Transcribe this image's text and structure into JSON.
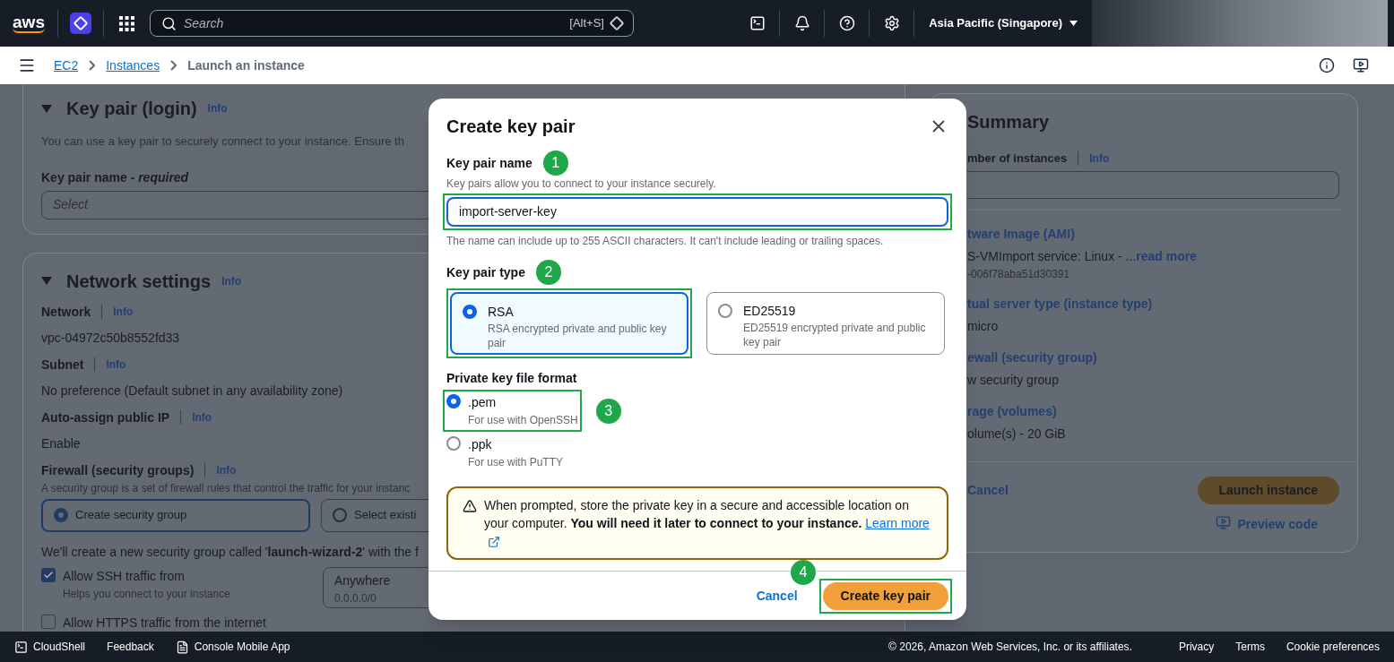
{
  "top_nav": {
    "logo": "aws",
    "search": {
      "placeholder": "Search",
      "shortcut": "[Alt+S]"
    },
    "region": "Asia Pacific (Singapore)"
  },
  "breadcrumbs": [
    {
      "label": "EC2",
      "link": true
    },
    {
      "label": "Instances",
      "link": true
    },
    {
      "label": "Launch an instance",
      "link": false
    }
  ],
  "background": {
    "key_pair_section": {
      "title": "Key pair (login)",
      "info": "Info",
      "description": "You can use a key pair to securely connect to your instance. Ensure th",
      "field_label": "Key pair name - *required*",
      "field_placeholder": "Select"
    },
    "network_section": {
      "title": "Network settings",
      "info": "Info",
      "fields": [
        {
          "label": "Network",
          "info": "Info",
          "value": "vpc-04972c50b8552fd33"
        },
        {
          "label": "Subnet",
          "info": "Info",
          "value": "No preference (Default subnet in any availability zone)"
        },
        {
          "label": "Auto-assign public IP",
          "info": "Info",
          "value": "Enable"
        }
      ],
      "firewall": {
        "label": "Firewall (security groups)",
        "info": "Info",
        "description": "A security group is a set of firewall rules that control the traffic for your instanc",
        "options": [
          {
            "label": "Create security group",
            "selected": true
          },
          {
            "label": "Select existi",
            "selected": false
          }
        ],
        "note": "We'll create a new security group called '**launch-wizard-2**' with the f",
        "rules": [
          {
            "label": "Allow SSH traffic from",
            "hint": "Helps you connect to your instance",
            "checked": true,
            "source": {
              "value": "Anywhere",
              "detail": "0.0.0.0/0"
            }
          },
          {
            "label": "Allow HTTPS traffic from the internet",
            "checked": false
          }
        ]
      }
    },
    "summary": {
      "title": "Summary",
      "instances_label": "mber of instances",
      "info": "Info",
      "items": [
        {
          "label": "tware Image (AMI)",
          "value": "S-VMImport service: Linux - ...",
          "link": "read more",
          "detail": "-006f78aba51d30391"
        },
        {
          "label": "tual server type (instance type)",
          "value": "micro"
        },
        {
          "label": "ewall (security group)",
          "value": "w security group"
        },
        {
          "label": "rage (volumes)",
          "value": "olume(s) - 20 GiB"
        }
      ],
      "cancel": "Cancel",
      "launch": "Launch instance",
      "preview": "Preview code"
    }
  },
  "modal": {
    "title": "Create key pair",
    "name_field": {
      "label": "Key pair name",
      "step": "1",
      "description": "Key pairs allow you to connect to your instance securely.",
      "value": "import-server-key",
      "constraint": "The name can include up to 255 ASCII characters. It can't include leading or trailing spaces.",
      "highlighted": true
    },
    "type_field": {
      "label": "Key pair type",
      "step": "2",
      "options": [
        {
          "label": "RSA",
          "description": "RSA encrypted private and public key pair",
          "selected": true,
          "highlighted": true
        },
        {
          "label": "ED25519",
          "description": "ED25519 encrypted private and public key pair",
          "selected": false,
          "highlighted": false
        }
      ]
    },
    "format_field": {
      "label": "Private key file format",
      "options": [
        {
          "label": ".pem",
          "description": "For use with OpenSSH",
          "selected": true,
          "highlighted": true,
          "step": "3"
        },
        {
          "label": ".ppk",
          "description": "For use with PuTTY",
          "selected": false,
          "highlighted": false
        }
      ]
    },
    "alert": {
      "text": "When prompted, store the private key in a secure and accessible location on your computer. **You will need it later to connect to your instance.**",
      "link": "Learn more"
    },
    "cancel": "Cancel",
    "submit": {
      "label": "Create key pair",
      "step": "4",
      "highlighted": true
    }
  },
  "footer": {
    "left": [
      {
        "kind": "cloudshell",
        "label": "CloudShell"
      },
      {
        "kind": "plain",
        "label": "Feedback"
      },
      {
        "kind": "mobile",
        "label": "Console Mobile App"
      }
    ],
    "copyright": "© 2026, Amazon Web Services, Inc. or its affiliates.",
    "links": [
      "Privacy",
      "Terms",
      "Cookie preferences"
    ]
  }
}
